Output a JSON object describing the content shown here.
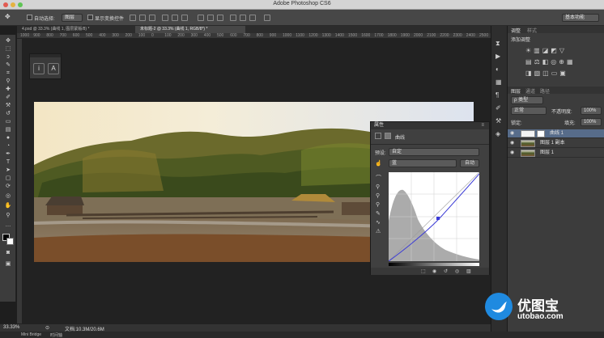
{
  "app": {
    "title": "Adobe Photoshop CS6"
  },
  "options_bar": {
    "auto_select_label": "自动选择:",
    "auto_select_value": "图层",
    "show_transform_label": "显示变换控件",
    "workspace": "基本功能"
  },
  "tabs": [
    {
      "label": "4.psd @ 33.3% (曲线 1, 图层蒙版/8) *"
    },
    {
      "label": "未标题-2 @ 33.3% (曲线 1, RGB/8*) *"
    }
  ],
  "ruler": {
    "ticks": [
      "1000",
      "900",
      "800",
      "700",
      "600",
      "500",
      "400",
      "300",
      "200",
      "100",
      "0",
      "100",
      "200",
      "300",
      "400",
      "500",
      "600",
      "700",
      "800",
      "900",
      "1000",
      "1100",
      "1200",
      "1300",
      "1400",
      "1500",
      "1600",
      "1700",
      "1800",
      "1900",
      "2000",
      "2100",
      "2200",
      "2300",
      "2400",
      "2500",
      "2600"
    ]
  },
  "float_palette": {
    "info_glyph": "i",
    "char_glyph": "A"
  },
  "properties": {
    "title": "属性",
    "adjustment_name": "曲线",
    "preset_label": "预设:",
    "preset_value": "自定",
    "channel_value": "蓝",
    "auto_button": "自动"
  },
  "right_panel": {
    "tab_adjustments": "调整",
    "tab_styles": "样式",
    "add_adjustment": "添加调整",
    "tab_layers": "图层",
    "tab_channels": "通道",
    "tab_paths": "路径",
    "kind_label": "ρ 类型",
    "blend_mode": "正常",
    "opacity_label": "不透明度:",
    "opacity_value": "100%",
    "lock_label": "锁定:",
    "fill_label": "填充:",
    "fill_value": "100%",
    "layers": [
      {
        "name": "曲线 1"
      },
      {
        "name": "图层 1 副本"
      },
      {
        "name": "图层 1"
      }
    ]
  },
  "status": {
    "zoom": "33.33%",
    "doc": "文档:10.3M/20.6M"
  },
  "bottom_tabs": [
    "Mini Bridge",
    "时间轴"
  ],
  "watermark": {
    "cn": "优图宝",
    "url": "utobao.com"
  }
}
